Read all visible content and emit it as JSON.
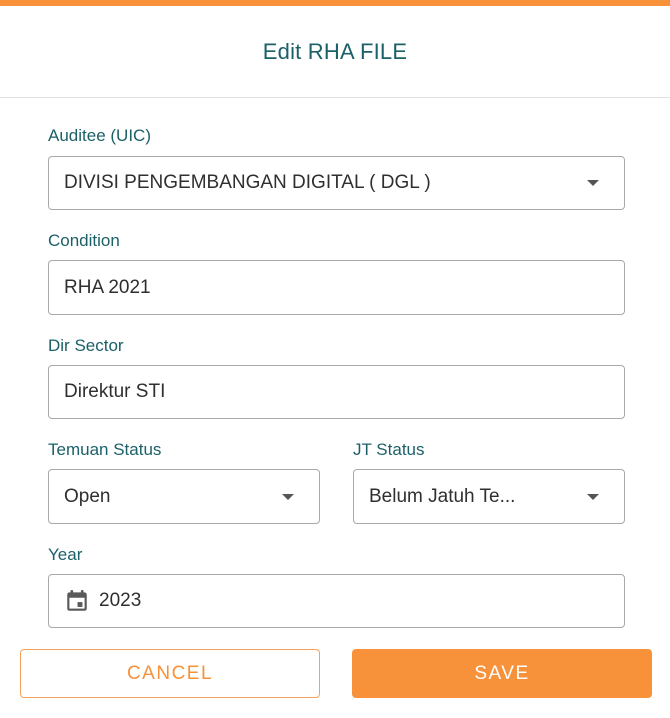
{
  "dialog": {
    "title": "Edit RHA FILE"
  },
  "form": {
    "auditee": {
      "label": "Auditee (UIC)",
      "value": "DIVISI PENGEMBANGAN DIGITAL ( DGL )"
    },
    "condition": {
      "label": "Condition",
      "value": "RHA 2021"
    },
    "dir_sector": {
      "label": "Dir Sector",
      "value": "Direktur STI"
    },
    "temuan_status": {
      "label": "Temuan Status",
      "value": "Open"
    },
    "jt_status": {
      "label": "JT Status",
      "value": "Belum Jatuh Te..."
    },
    "year": {
      "label": "Year",
      "value": "2023",
      "icon": "calendar-icon"
    }
  },
  "actions": {
    "cancel_label": "CANCEL",
    "save_label": "SAVE"
  },
  "colors": {
    "accent": "#f7923a",
    "label": "#1c6068",
    "border": "#a9a9a9"
  }
}
